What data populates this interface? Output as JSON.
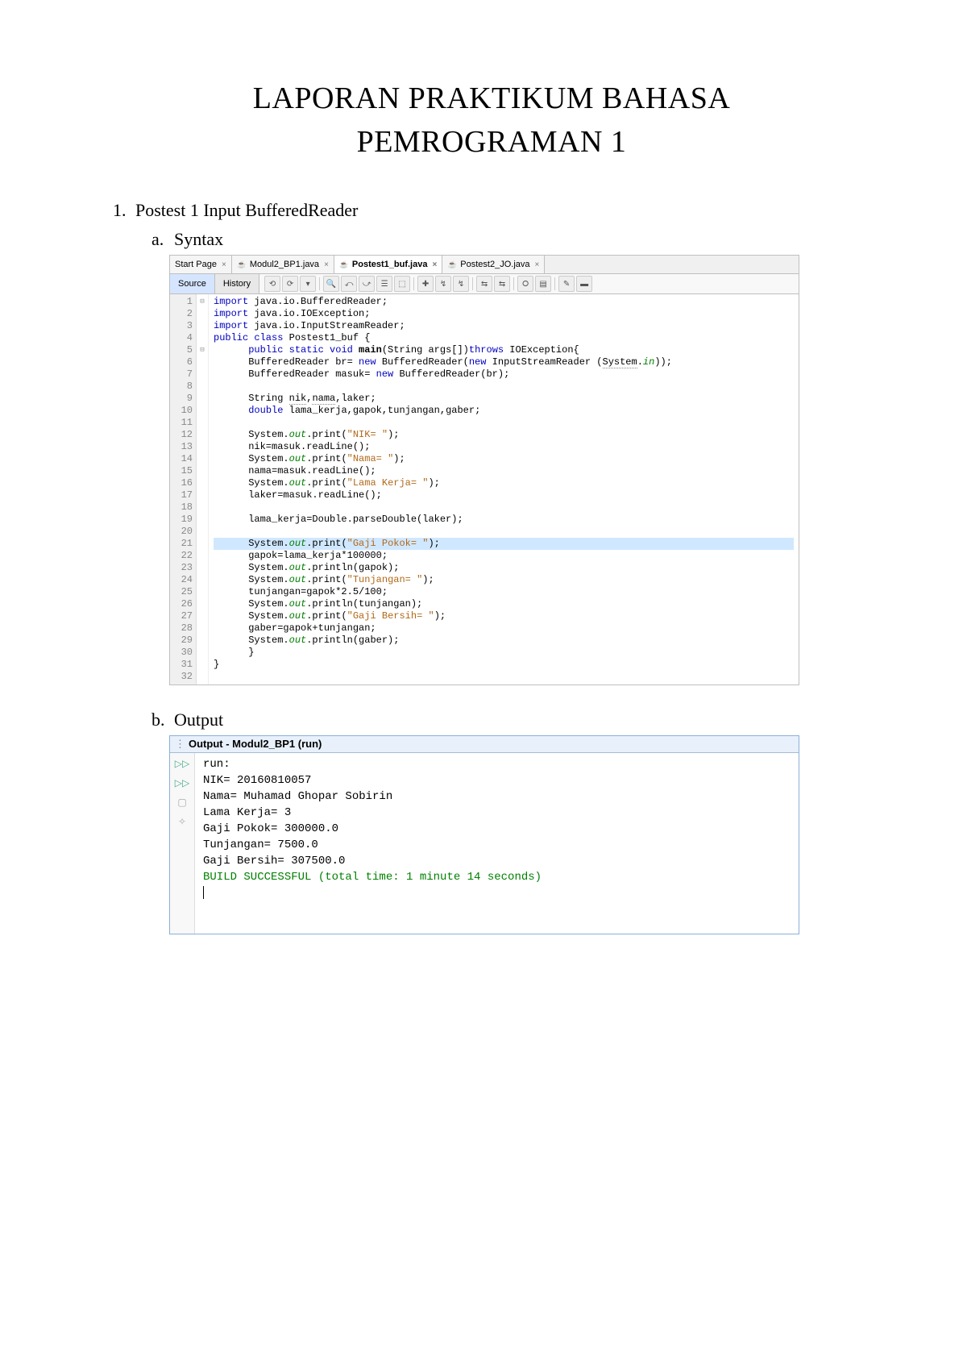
{
  "title_line1": "LAPORAN PRAKTIKUM BAHASA",
  "title_line2": "PEMROGRAMAN 1",
  "section1": {
    "num": "1.",
    "text": "Postest 1 Input BufferedReader"
  },
  "sub_a": {
    "let": "a.",
    "text": "Syntax"
  },
  "sub_b": {
    "let": "b.",
    "text": "Output"
  },
  "ide": {
    "tabs": [
      {
        "label": "Start Page",
        "icon": "",
        "active": false
      },
      {
        "label": "Modul2_BP1.java",
        "icon": "☕",
        "active": false
      },
      {
        "label": "Postest1_buf.java",
        "icon": "☕",
        "active": true
      },
      {
        "label": "Postest2_JO.java",
        "icon": "☕",
        "active": false
      }
    ],
    "views": {
      "source": "Source",
      "history": "History"
    },
    "toolbar_icons": [
      "⟲",
      "⟳",
      "▾",
      "",
      "🔍",
      "⤺",
      "⤻",
      "☰",
      "⬚",
      "",
      "✚",
      "↯",
      "↯",
      "",
      "⇆",
      "⇆",
      "",
      "⭘",
      "▤",
      "",
      "✎",
      "▬"
    ],
    "gutter": [
      "1",
      "2",
      "3",
      "4",
      "5",
      "6",
      "7",
      "8",
      "9",
      "10",
      "11",
      "12",
      "13",
      "14",
      "15",
      "16",
      "17",
      "18",
      "19",
      "20",
      "21",
      "22",
      "23",
      "24",
      "25",
      "26",
      "27",
      "28",
      "29",
      "30",
      "31",
      "32"
    ],
    "fold": [
      "⊟",
      "",
      "",
      "",
      "⊟",
      "",
      "",
      "",
      "",
      "",
      "",
      "",
      "",
      "",
      "",
      "",
      "",
      "",
      "",
      "",
      "",
      "",
      "",
      "",
      "",
      "",
      "",
      "",
      "",
      "",
      "",
      ""
    ],
    "code_lines": [
      [
        {
          "t": "import",
          "c": "kw"
        },
        {
          "t": " java.io.BufferedReader;"
        }
      ],
      [
        {
          "t": "import",
          "c": "kw"
        },
        {
          "t": " java.io.IOException;"
        }
      ],
      [
        {
          "t": "import",
          "c": "kw"
        },
        {
          "t": " java.io.InputStreamReader;"
        }
      ],
      [
        {
          "t": "public class ",
          "c": "kw"
        },
        {
          "t": "Postest1_buf {"
        }
      ],
      [
        {
          "t": "      "
        },
        {
          "t": "public static void ",
          "c": "kw"
        },
        {
          "t": "main",
          "b": true
        },
        {
          "t": "(String args[])"
        },
        {
          "t": "throws",
          "c": "kw"
        },
        {
          "t": " IOException{"
        }
      ],
      [
        {
          "t": "      BufferedReader br= "
        },
        {
          "t": "new",
          "c": "kw"
        },
        {
          "t": " BufferedReader("
        },
        {
          "t": "new",
          "c": "kw"
        },
        {
          "t": " InputStreamReader ("
        },
        {
          "t": "System",
          "u": true
        },
        {
          "t": "."
        },
        {
          "t": "in",
          "c": "fld"
        },
        {
          "t": "));"
        }
      ],
      [
        {
          "t": "      BufferedReader masuk= "
        },
        {
          "t": "new",
          "c": "kw"
        },
        {
          "t": " BufferedReader(br);"
        }
      ],
      [
        {
          "t": ""
        }
      ],
      [
        {
          "t": "      String "
        },
        {
          "t": "nik",
          "u": true
        },
        {
          "t": ","
        },
        {
          "t": "nama",
          "u": true
        },
        {
          "t": ",laker;"
        }
      ],
      [
        {
          "t": "      "
        },
        {
          "t": "double",
          "c": "kw"
        },
        {
          "t": " lama_kerja,gapok,tunjangan,gaber;"
        }
      ],
      [
        {
          "t": ""
        }
      ],
      [
        {
          "t": "      System."
        },
        {
          "t": "out",
          "c": "fld"
        },
        {
          "t": ".print("
        },
        {
          "t": "\"NIK= \"",
          "c": "str"
        },
        {
          "t": ");"
        }
      ],
      [
        {
          "t": "      nik=masuk.readLine();"
        }
      ],
      [
        {
          "t": "      System."
        },
        {
          "t": "out",
          "c": "fld"
        },
        {
          "t": ".print("
        },
        {
          "t": "\"Nama= \"",
          "c": "str"
        },
        {
          "t": ");"
        }
      ],
      [
        {
          "t": "      nama=masuk.readLine();"
        }
      ],
      [
        {
          "t": "      System."
        },
        {
          "t": "out",
          "c": "fld"
        },
        {
          "t": ".print("
        },
        {
          "t": "\"Lama Kerja= \"",
          "c": "str"
        },
        {
          "t": ");"
        }
      ],
      [
        {
          "t": "      laker=masuk.readLine();"
        }
      ],
      [
        {
          "t": ""
        }
      ],
      [
        {
          "t": "      lama_kerja=Double.parseDouble(laker);"
        }
      ],
      [
        {
          "t": ""
        }
      ],
      [
        {
          "t": "      System."
        },
        {
          "t": "out",
          "c": "fld"
        },
        {
          "t": ".print("
        },
        {
          "t": "\"Gaji Pokok= \"",
          "c": "str"
        },
        {
          "t": ");"
        }
      ],
      [
        {
          "t": "      gapok=lama_kerja*100000;"
        }
      ],
      [
        {
          "t": "      System."
        },
        {
          "t": "out",
          "c": "fld"
        },
        {
          "t": ".println(gapok);"
        }
      ],
      [
        {
          "t": "      System."
        },
        {
          "t": "out",
          "c": "fld"
        },
        {
          "t": ".print("
        },
        {
          "t": "\"Tunjangan= \"",
          "c": "str"
        },
        {
          "t": ");"
        }
      ],
      [
        {
          "t": "      tunjangan=gapok*2.5/100;"
        }
      ],
      [
        {
          "t": "      System."
        },
        {
          "t": "out",
          "c": "fld"
        },
        {
          "t": ".println(tunjangan);"
        }
      ],
      [
        {
          "t": "      System."
        },
        {
          "t": "out",
          "c": "fld"
        },
        {
          "t": ".print("
        },
        {
          "t": "\"Gaji Bersih= \"",
          "c": "str"
        },
        {
          "t": ");"
        }
      ],
      [
        {
          "t": "      gaber=gapok+tunjangan;"
        }
      ],
      [
        {
          "t": "      System."
        },
        {
          "t": "out",
          "c": "fld"
        },
        {
          "t": ".println(gaber);"
        }
      ],
      [
        {
          "t": "      }"
        }
      ],
      [
        {
          "t": "}"
        }
      ],
      [
        {
          "t": ""
        }
      ]
    ],
    "highlight_line_index": 20
  },
  "output": {
    "title": "Output - Modul2_BP1 (run)",
    "lines": [
      {
        "t": "run:"
      },
      {
        "t": "NIK= 20160810057"
      },
      {
        "t": "Nama= Muhamad Ghopar Sobirin"
      },
      {
        "t": "Lama Kerja= 3"
      },
      {
        "t": "Gaji Pokok= 300000.0"
      },
      {
        "t": "Tunjangan= 7500.0"
      },
      {
        "t": "Gaji Bersih= 307500.0"
      },
      {
        "t": "BUILD SUCCESSFUL (total time: 1 minute 14 seconds)",
        "c": "build"
      }
    ],
    "gutter_icons": [
      "▷▷",
      "▷▷",
      "▢",
      "✧"
    ]
  }
}
